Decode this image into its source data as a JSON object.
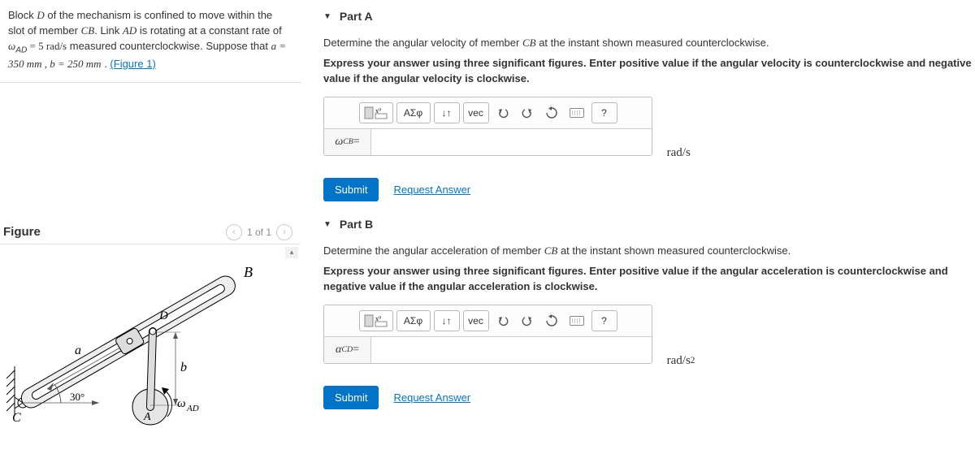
{
  "problem": {
    "text_parts": {
      "p1a": "Block ",
      "p1b": " of the mechanism is confined to move within the slot of member ",
      "p1c": ". Link ",
      "p1d": " is rotating at a constant rate of ",
      "p1e": " measured counterclockwise. Suppose that ",
      "p1f": " . "
    },
    "vars": {
      "D": "D",
      "CB": "CB",
      "AD": "AD",
      "wAD_lhs": "ω",
      "wAD_sub": "AD",
      "wAD_eq": " = 5  rad/s",
      "a_eq": "a = 350  mm , b = 250  mm",
      "figlink": "(Figure 1)"
    }
  },
  "figure": {
    "title": "Figure",
    "counter": "1 of 1",
    "labels": {
      "a": "a",
      "b": "b",
      "B": "B",
      "D": "D",
      "C": "C",
      "A": "A",
      "angle": "30°",
      "wAD": "ω",
      "wAD_sub": "AD"
    }
  },
  "partA": {
    "title": "Part A",
    "prompt1_a": "Determine the angular velocity of member ",
    "prompt1_b": " at the instant shown measured counterclockwise.",
    "prompt2": "Express your answer using three significant figures. Enter positive value if the angular velocity is counterclockwise and negative value if the angular velocity is clockwise.",
    "lhs_w": "ω",
    "lhs_sub": "CB",
    "lhs_eq": " =",
    "units": "rad/s",
    "submit": "Submit",
    "request": "Request Answer"
  },
  "partB": {
    "title": "Part B",
    "prompt1_a": "Determine the angular acceleration of member ",
    "prompt1_b": " at the instant shown measured counterclockwise.",
    "prompt2": "Express your answer using three significant figures. Enter positive value if the angular acceleration is counterclockwise and negative value if the angular acceleration is clockwise.",
    "lhs_a": "α",
    "lhs_sub": "CD",
    "lhs_eq": " =",
    "units_a": "rad/s",
    "units_sup": "2",
    "submit": "Submit",
    "request": "Request Answer"
  },
  "toolbar": {
    "templates_label": "",
    "greek": "ΑΣφ",
    "sub": "↓↑",
    "vec": "vec",
    "help": "?"
  }
}
